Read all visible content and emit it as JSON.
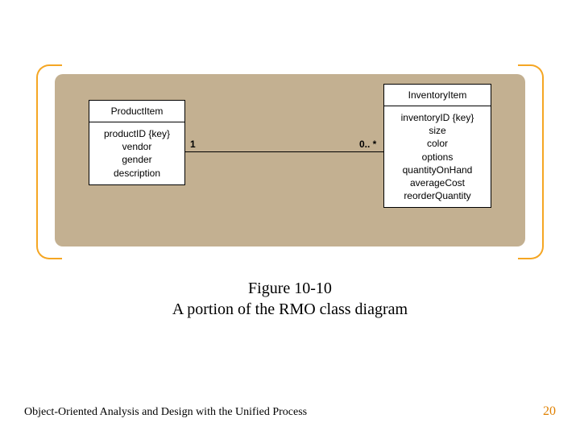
{
  "diagram": {
    "classes": {
      "left": {
        "name": "ProductItem",
        "attrs": [
          "productID {key}",
          "vendor",
          "gender",
          "description"
        ]
      },
      "right": {
        "name": "InventoryItem",
        "attrs": [
          "inventoryID {key}",
          "size",
          "color",
          "options",
          "quantityOnHand",
          "averageCost",
          "reorderQuantity"
        ]
      }
    },
    "association": {
      "leftMult": "1",
      "rightMult": "0.. *"
    }
  },
  "caption": {
    "line1": "Figure 10-10",
    "line2": "A portion of the RMO class diagram"
  },
  "footer": {
    "left": "Object-Oriented Analysis and Design with the Unified Process",
    "right": "20"
  }
}
